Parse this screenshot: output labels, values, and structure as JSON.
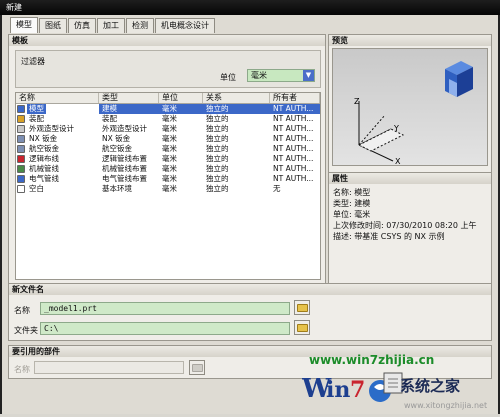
{
  "window": {
    "title": "新建"
  },
  "tabs": [
    {
      "label": "模型",
      "active": true
    },
    {
      "label": "图纸",
      "active": false
    },
    {
      "label": "仿真",
      "active": false
    },
    {
      "label": "加工",
      "active": false
    },
    {
      "label": "检测",
      "active": false
    },
    {
      "label": "机电概念设计",
      "active": false
    }
  ],
  "templates": {
    "header": "模板",
    "filter": {
      "label": "过滤器",
      "unit_label": "单位",
      "unit_value": "毫米"
    },
    "columns": [
      "名称",
      "类型",
      "单位",
      "关系",
      "所有者"
    ],
    "rows": [
      {
        "icon": "model-icon",
        "name": "模型",
        "type": "建模",
        "unit": "毫米",
        "relation": "独立的",
        "owner": "NT AUTH...",
        "selected": true
      },
      {
        "icon": "assembly-icon",
        "name": "装配",
        "type": "装配",
        "unit": "毫米",
        "relation": "独立的",
        "owner": "NT AUTH...",
        "selected": false
      },
      {
        "icon": "shape-design-icon",
        "name": "外观造型设计",
        "type": "外观造型设计",
        "unit": "毫米",
        "relation": "独立的",
        "owner": "NT AUTH...",
        "selected": false
      },
      {
        "icon": "sheet-metal-icon",
        "name": "NX 钣金",
        "type": "NX 钣金",
        "unit": "毫米",
        "relation": "独立的",
        "owner": "NT AUTH...",
        "selected": false
      },
      {
        "icon": "aero-sheet-metal-icon",
        "name": "航空钣金",
        "type": "航空钣金",
        "unit": "毫米",
        "relation": "独立的",
        "owner": "NT AUTH...",
        "selected": false
      },
      {
        "icon": "logic-routing-icon",
        "name": "逻辑布线",
        "type": "逻辑管线布置",
        "unit": "毫米",
        "relation": "独立的",
        "owner": "NT AUTH...",
        "selected": false
      },
      {
        "icon": "mech-piping-icon",
        "name": "机械管线",
        "type": "机械管线布置",
        "unit": "毫米",
        "relation": "独立的",
        "owner": "NT AUTH...",
        "selected": false
      },
      {
        "icon": "elec-routing-icon",
        "name": "电气管线",
        "type": "电气管线布置",
        "unit": "毫米",
        "relation": "独立的",
        "owner": "NT AUTH...",
        "selected": false
      },
      {
        "icon": "blank-icon",
        "name": "空白",
        "type": "基本环境",
        "unit": "毫米",
        "relation": "独立的",
        "owner": "无",
        "selected": false
      }
    ]
  },
  "preview": {
    "header": "预览",
    "axis_x": "X",
    "axis_y": "Y",
    "axis_z": "Z"
  },
  "properties": {
    "header": "属性",
    "items": [
      {
        "key": "名称:",
        "value": "模型"
      },
      {
        "key": "类型:",
        "value": "建模"
      },
      {
        "key": "单位:",
        "value": "毫米"
      },
      {
        "key": "上次修改时间:",
        "value": "07/30/2010 08:20 上午"
      },
      {
        "key": "描述:",
        "value": "带基准 CSYS 的 NX 示例"
      }
    ]
  },
  "new_file": {
    "header": "新文件名",
    "name_label": "名称",
    "name_value": "_model1.prt",
    "folder_label": "文件夹",
    "folder_value": "C:\\"
  },
  "referenced": {
    "header": "要引用的部件",
    "name_label": "名称",
    "name_value": ""
  },
  "watermark": {
    "url": "www.win7zhijia.cn",
    "brand": "系统之家",
    "small": "www.xitongzhijia.net"
  },
  "colors": {
    "accent": "#3c68c8",
    "field_green": "#cfe9c8"
  }
}
